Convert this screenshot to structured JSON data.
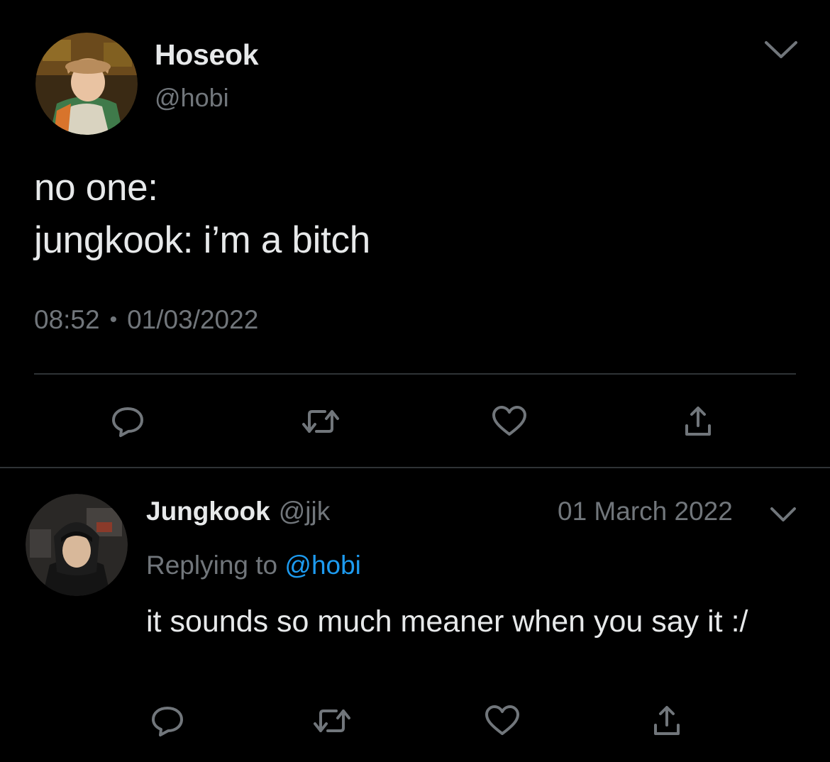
{
  "main_tweet": {
    "author_name": "Hoseok",
    "author_handle": "@hobi",
    "text_lines": [
      "no one:",
      "jungkook: i’m a bitch"
    ],
    "time": "08:52",
    "separator": "•",
    "date": "01/03/2022",
    "actions": [
      "reply-icon",
      "retweet-icon",
      "like-icon",
      "share-icon"
    ]
  },
  "reply_tweet": {
    "author_name": "Jungkook",
    "author_handle": "@jjk",
    "date": "01 March 2022",
    "replying_prefix": "Replying to",
    "replying_mention": "@hobi",
    "text": "it sounds so much meaner when you say it :/",
    "actions": [
      "reply-icon",
      "retweet-icon",
      "like-icon",
      "share-icon"
    ]
  },
  "colors": {
    "background": "#000000",
    "primary_text": "#e7e9ea",
    "secondary_text": "#71767b",
    "accent": "#1d9bf0",
    "divider": "#2f3336"
  }
}
